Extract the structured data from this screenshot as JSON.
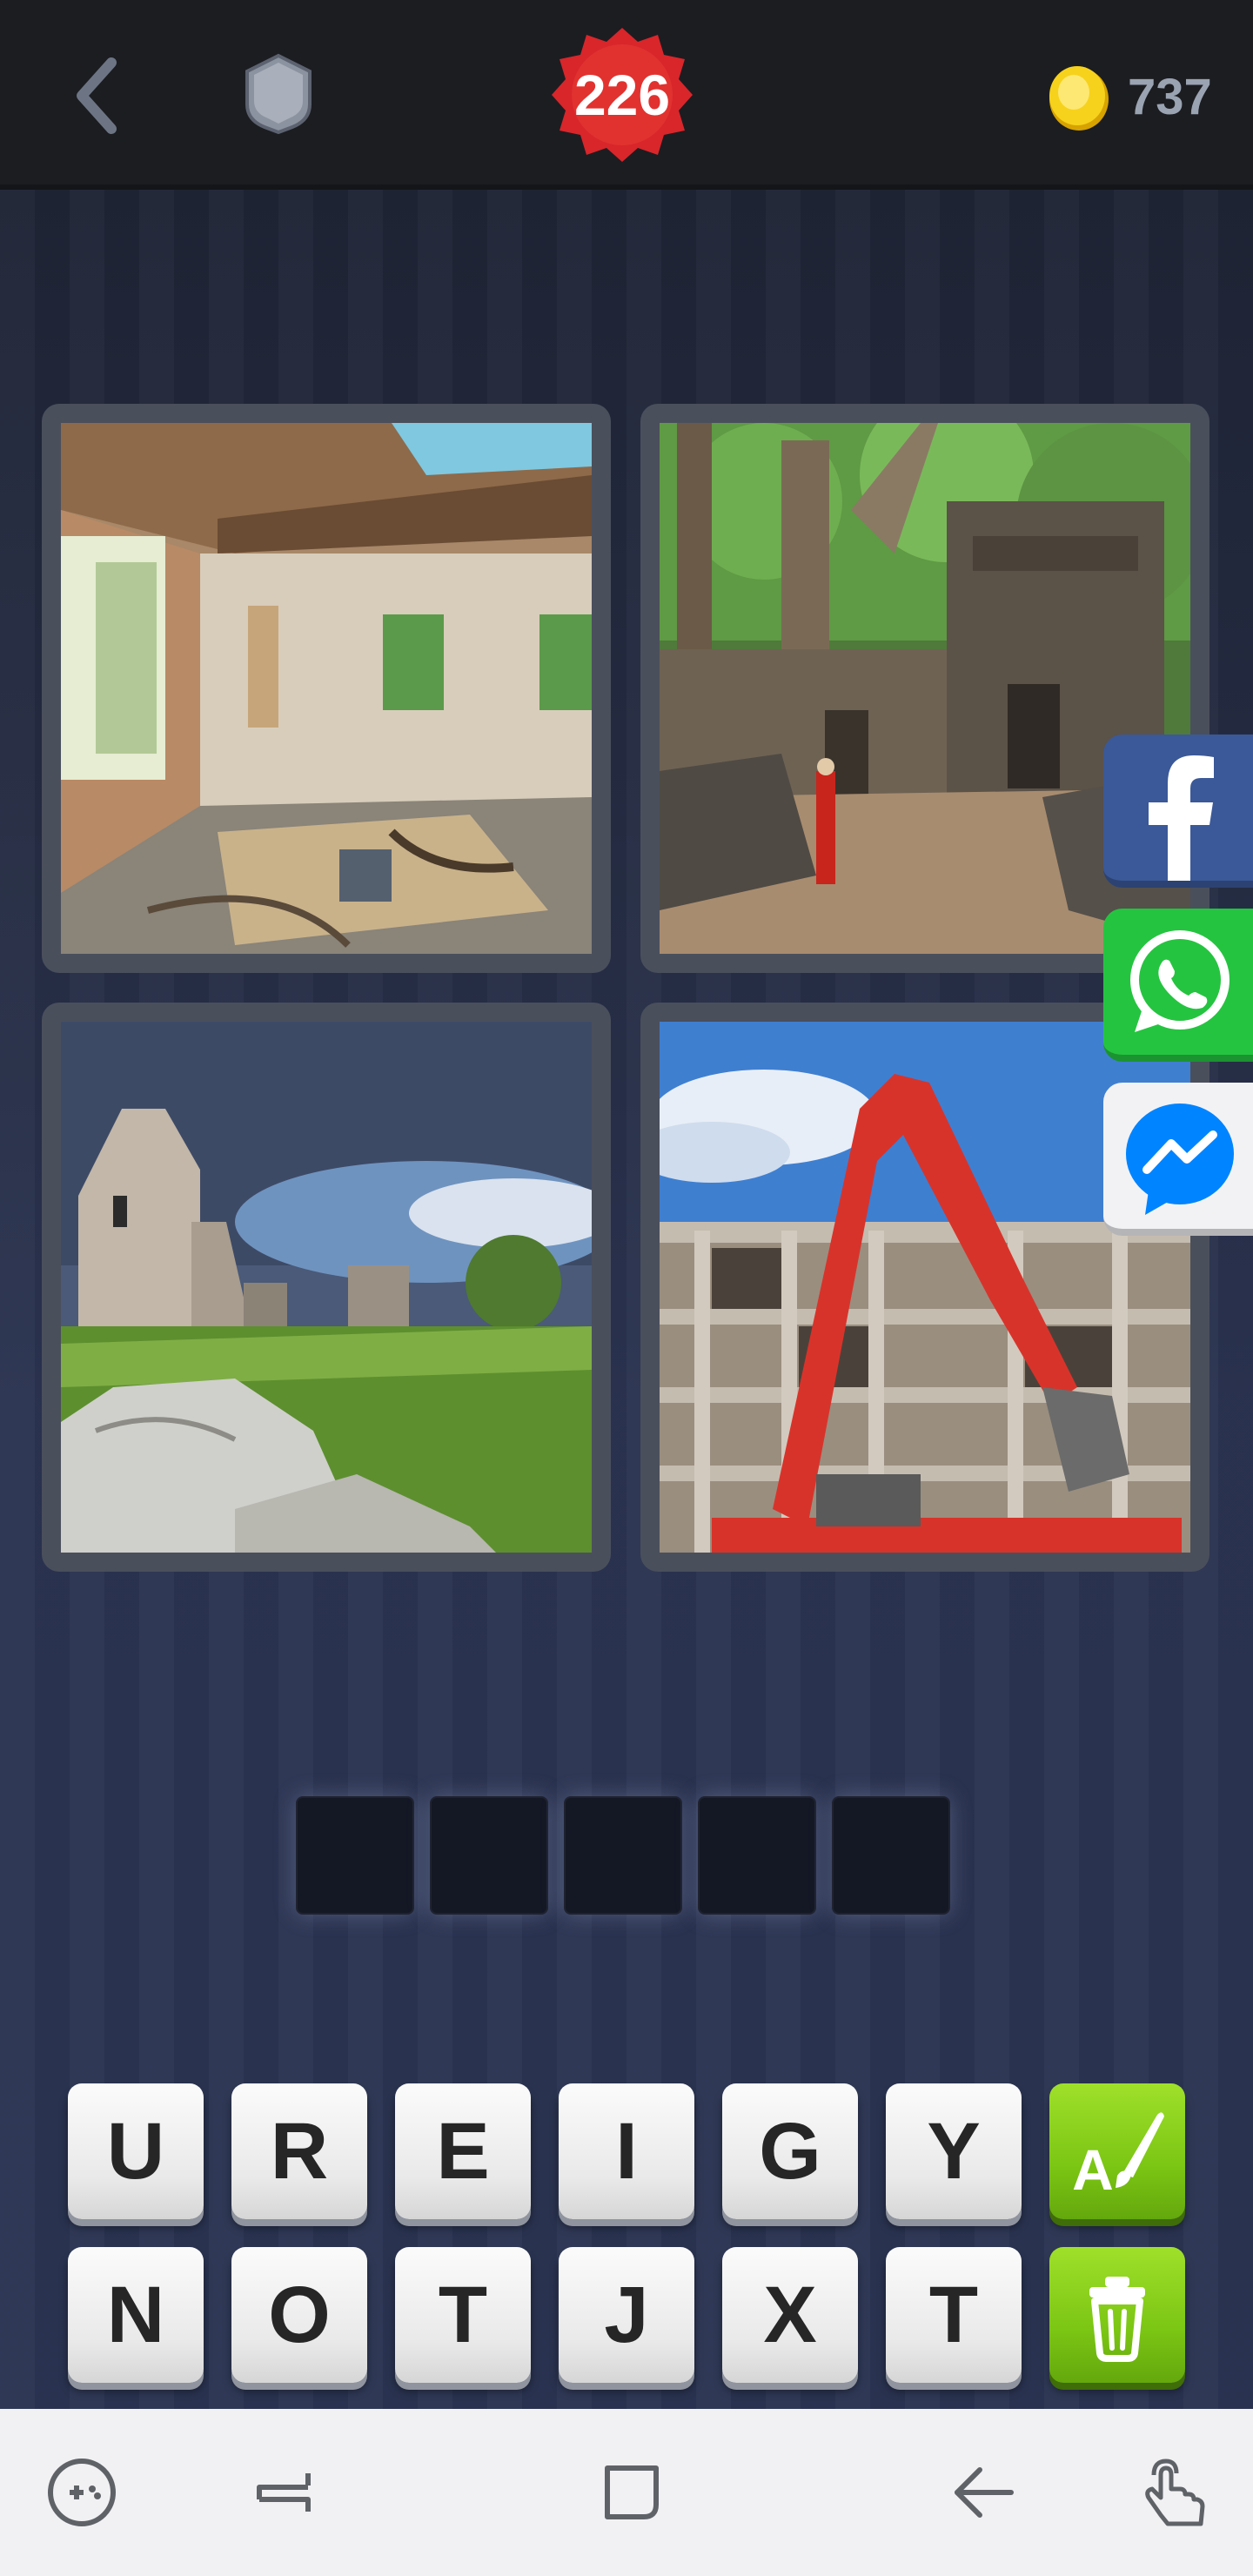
{
  "header": {
    "back_icon": "chevron-left-icon",
    "shield_icon": "shield-icon",
    "level": "226",
    "level_badge_color": "#d8262b",
    "coin_icon": "gold-coin-icon",
    "coins": "737"
  },
  "puzzle": {
    "images": [
      {
        "subject": "abandoned-room-photo"
      },
      {
        "subject": "jungle-temple-ruins-photo"
      },
      {
        "subject": "castle-ruins-photo"
      },
      {
        "subject": "demolition-excavator-photo"
      }
    ],
    "answer_length": 5,
    "answer_slots": [
      "",
      "",
      "",
      "",
      ""
    ]
  },
  "share": {
    "facebook_color": "#3b5998",
    "whatsapp_color": "#25c440",
    "messenger_color": "#0084ff"
  },
  "keyboard": {
    "row1": [
      "U",
      "R",
      "E",
      "I",
      "G",
      "Y"
    ],
    "row2": [
      "N",
      "O",
      "T",
      "J",
      "X",
      "T"
    ],
    "hint_icon": "reveal-letter-icon",
    "remove_icon": "trash-can-icon",
    "accent": "#7cc614"
  },
  "system_nav": {
    "icons": [
      "game-launcher-icon",
      "recent-apps-icon",
      "home-icon",
      "back-icon",
      "touch-gesture-icon"
    ]
  }
}
